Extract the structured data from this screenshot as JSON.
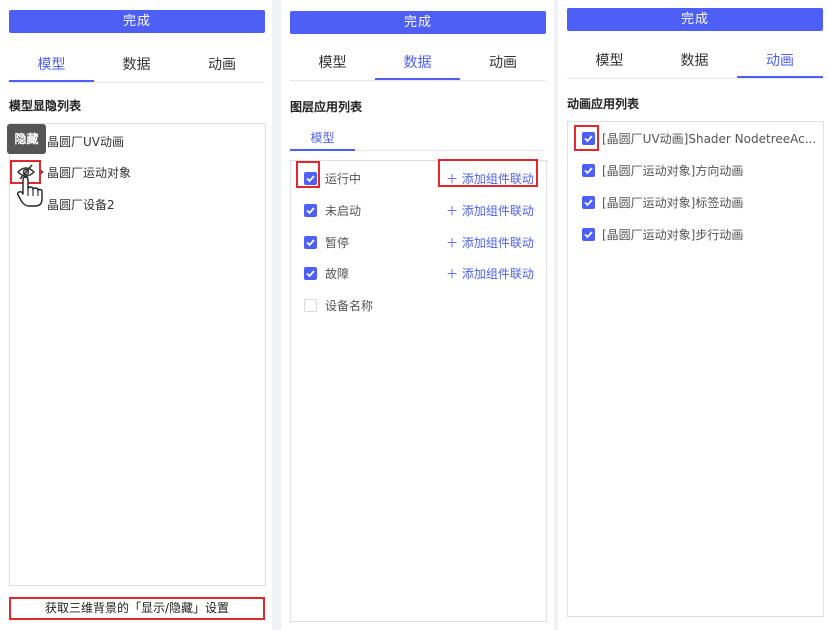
{
  "colors": {
    "accent": "#4e5ff5",
    "highlight_red": "#e0282e",
    "gutter": "#f0f2f5"
  },
  "panel1": {
    "done_label": "完成",
    "tabs": [
      {
        "label": "模型",
        "active": true
      },
      {
        "label": "数据",
        "active": false
      },
      {
        "label": "动画",
        "active": false
      }
    ],
    "section_title": "模型显隐列表",
    "tooltip": "隐藏",
    "items": [
      {
        "label": "晶圆厂UV动画"
      },
      {
        "label": "晶圆厂运动对象"
      },
      {
        "label": "晶圆厂设备2"
      }
    ],
    "icons": {
      "hide": "eye-slash-icon",
      "cursor": "hand-pointer-icon"
    },
    "footer_button": "获取三维背景的「显示/隐藏」设置"
  },
  "panel2": {
    "done_label": "完成",
    "tabs": [
      {
        "label": "模型",
        "active": false
      },
      {
        "label": "数据",
        "active": true
      },
      {
        "label": "动画",
        "active": false
      }
    ],
    "section_title": "图层应用列表",
    "subtab": "模型",
    "items": [
      {
        "label": "运行中",
        "checked": true,
        "action": "＋ 添加组件联动"
      },
      {
        "label": "未启动",
        "checked": true,
        "action": "＋ 添加组件联动"
      },
      {
        "label": "暂停",
        "checked": true,
        "action": "＋ 添加组件联动"
      },
      {
        "label": "故障",
        "checked": true,
        "action": "＋ 添加组件联动"
      },
      {
        "label": "设备名称",
        "checked": false,
        "action": ""
      }
    ]
  },
  "panel3": {
    "done_label": "完成",
    "tabs": [
      {
        "label": "模型",
        "active": false
      },
      {
        "label": "数据",
        "active": false
      },
      {
        "label": "动画",
        "active": true
      }
    ],
    "section_title": "动画应用列表",
    "items": [
      {
        "label": "[晶圆厂UV动画]Shader NodetreeAc...",
        "checked": true
      },
      {
        "label": "[晶圆厂运动对象]方向动画",
        "checked": true
      },
      {
        "label": "[晶圆厂运动对象]标签动画",
        "checked": true
      },
      {
        "label": "[晶圆厂运动对象]步行动画",
        "checked": true
      }
    ]
  }
}
